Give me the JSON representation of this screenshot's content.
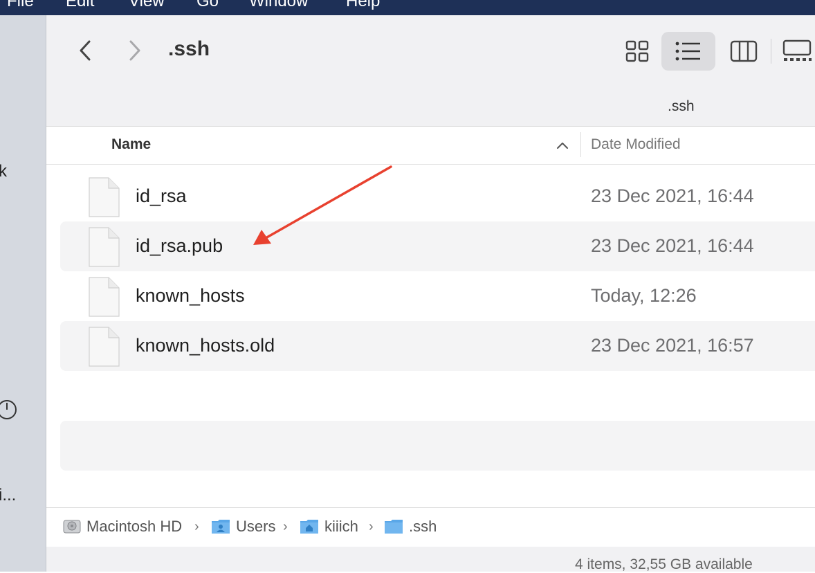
{
  "menu": [
    "File",
    "Edit",
    "View",
    "Go",
    "Window",
    "Help"
  ],
  "sidebar_fragments": [
    "k",
    "i..."
  ],
  "window": {
    "title": ".ssh",
    "path_title": ".ssh"
  },
  "view_modes": [
    "icon-view",
    "list-view",
    "column-view",
    "gallery-view"
  ],
  "active_view": "list-view",
  "columns": {
    "name": "Name",
    "date_modified": "Date Modified",
    "sort": "ascending"
  },
  "files": [
    {
      "name": "id_rsa",
      "date": "23 Dec 2021, 16:44"
    },
    {
      "name": "id_rsa.pub",
      "date": "23 Dec 2021, 16:44"
    },
    {
      "name": "known_hosts",
      "date": "Today, 12:26"
    },
    {
      "name": "known_hosts.old",
      "date": "23 Dec 2021, 16:57"
    }
  ],
  "path_bar": [
    {
      "label": "Macintosh HD",
      "icon": "hard-drive-icon"
    },
    {
      "label": "Users",
      "icon": "users-folder-icon"
    },
    {
      "label": "kiiich",
      "icon": "home-folder-icon"
    },
    {
      "label": ".ssh",
      "icon": "folder-icon"
    }
  ],
  "status": "4 items, 32,55 GB available",
  "colors": {
    "menubar": "#1e3057",
    "sidebar": "#d5d9e0",
    "toolbar": "#f1f1f3",
    "row_alt": "#f4f4f5",
    "folder_blue": "#5aa7e8",
    "annotation_arrow": "#e8412f"
  },
  "annotation": {
    "type": "arrow",
    "points_to": "id_rsa.pub"
  }
}
